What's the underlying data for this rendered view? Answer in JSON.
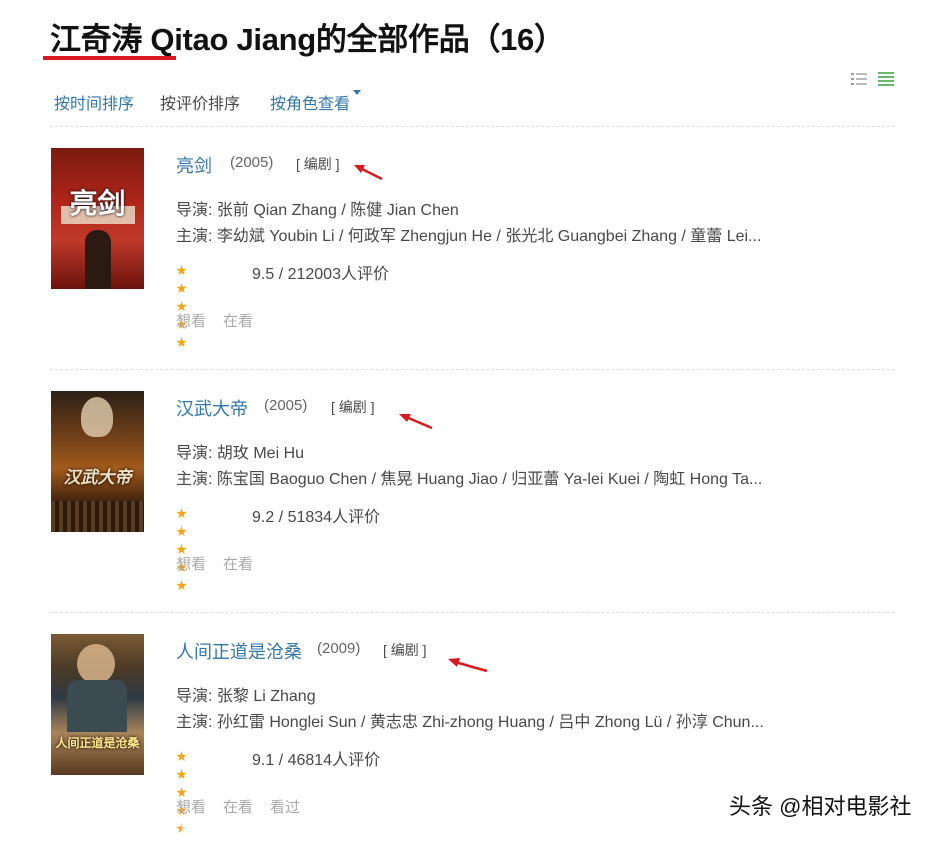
{
  "page": {
    "title": "江奇涛 Qitao Jiang的全部作品（16）"
  },
  "sort": {
    "by_time": "按时间排序",
    "by_rating": "按评价排序",
    "by_role": "按角色查看"
  },
  "colors": {
    "link": "#3377aa",
    "star": "#f9a20a",
    "underline": "#d9191f",
    "arrow": "#d9191f",
    "grid_toggle": "#6ab870"
  },
  "works": [
    {
      "poster_text": "亮剑",
      "title": "亮剑",
      "year": "(2005)",
      "role": "[ 编剧 ]",
      "director": "导演: 张前 Qian Zhang / 陈健 Jian Chen",
      "cast": "主演: 李幼斌 Youbin Li / 何政军 Zhengjun He / 张光北 Guangbei Zhang / 童蕾 Lei...",
      "stars": 5,
      "rating": "9.5 / 212003人评价",
      "actions": [
        "想看",
        "在看"
      ]
    },
    {
      "poster_text": "汉武大帝",
      "title": "汉武大帝",
      "year": "(2005)",
      "role": "[ 编剧 ]",
      "director": "导演: 胡玫 Mei Hu",
      "cast": "主演: 陈宝国 Baoguo Chen / 焦晃 Huang Jiao / 归亚蕾 Ya-lei Kuei / 陶虹 Hong Ta...",
      "stars": 5,
      "rating": "9.2 / 51834人评价",
      "actions": [
        "想看",
        "在看"
      ]
    },
    {
      "poster_text": "人间正道是沧桑",
      "title": "人间正道是沧桑",
      "year": "(2009)",
      "role": "[ 编剧 ]",
      "director": "导演: 张黎 Li Zhang",
      "cast": "主演: 孙红雷 Honglei Sun / 黄志忠 Zhi-zhong Huang / 吕中 Zhong Lü / 孙淳 Chun...",
      "stars": 4.5,
      "rating": "9.1 / 46814人评价",
      "actions": [
        "想看",
        "在看",
        "看过"
      ]
    }
  ],
  "watermark": "头条 @相对电影社"
}
